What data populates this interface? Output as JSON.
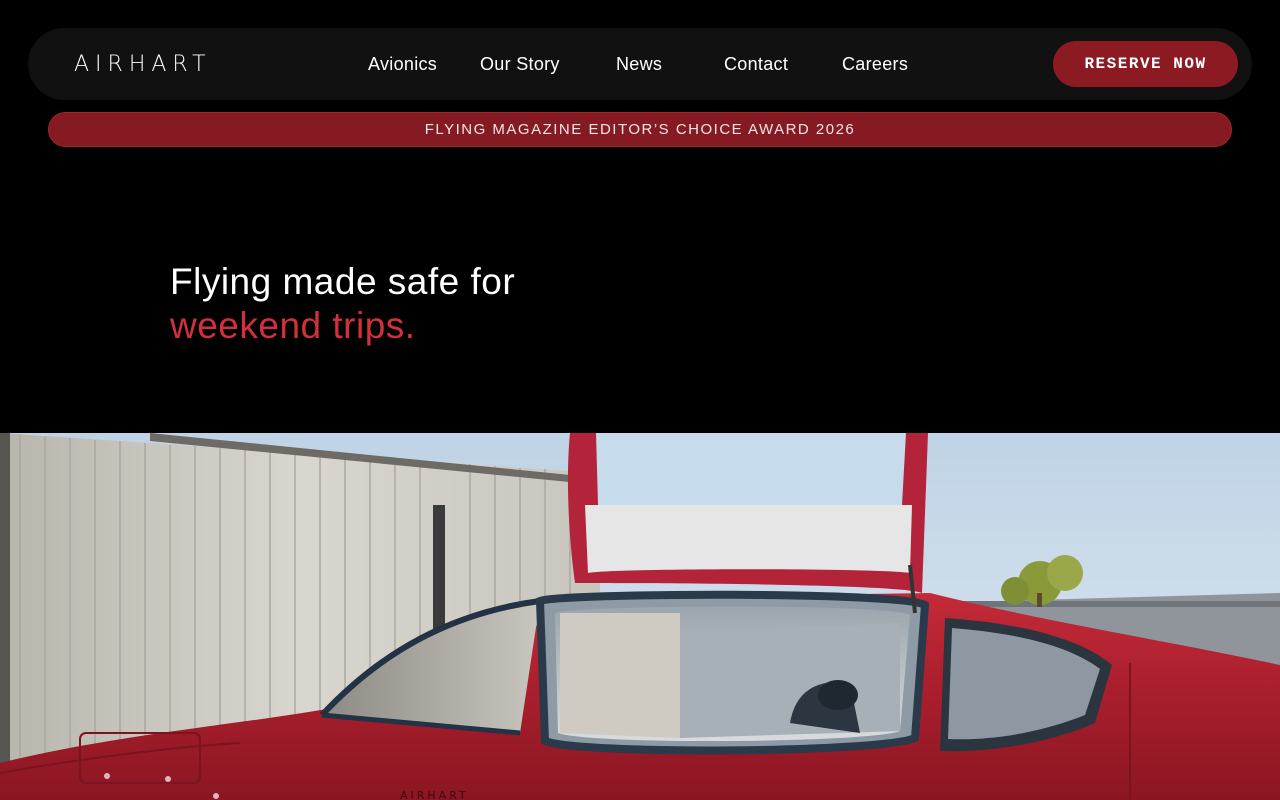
{
  "brand": {
    "logo_text": "AIRHART"
  },
  "nav": {
    "links": [
      {
        "label": "Avionics"
      },
      {
        "label": "Our Story"
      },
      {
        "label": "News"
      },
      {
        "label": "Contact"
      },
      {
        "label": "Careers"
      }
    ],
    "cta_label": "RESERVE NOW"
  },
  "banner": {
    "text": "FLYING MAGAZINE EDITOR’S CHOICE AWARD 2026"
  },
  "hero": {
    "line1": "Flying made safe for",
    "line2": "weekend trips."
  },
  "aircraft_livery_text": "AIRHART",
  "colors": {
    "accent": "#8b1a22",
    "highlight_text": "#d2303c",
    "background": "#000000",
    "nav_background": "#111111",
    "aircraft_red": "#b02030"
  }
}
